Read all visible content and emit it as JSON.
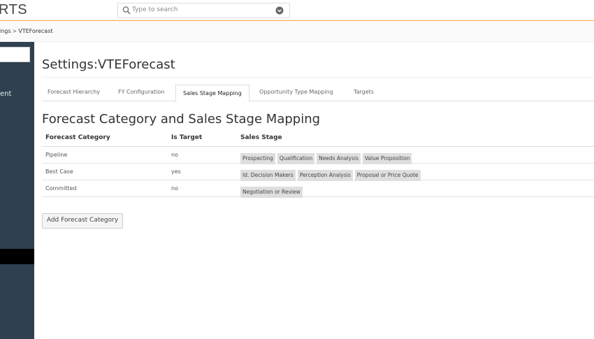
{
  "app": {
    "logo_text": "RTS"
  },
  "search": {
    "placeholder": "Type to search"
  },
  "breadcrumb": {
    "parent": "ings",
    "separator": ">",
    "current": "VTEForecast"
  },
  "sidebar": {
    "partial_item_label": "ent"
  },
  "page": {
    "title": "Settings:VTEForecast"
  },
  "tabs": [
    {
      "label": "Forecast Hierarchy",
      "active": false
    },
    {
      "label": "FY Configuration",
      "active": false
    },
    {
      "label": "Sales Stage Mapping",
      "active": true
    },
    {
      "label": "Opportunity Type Mapping",
      "active": false
    },
    {
      "label": "Targets",
      "active": false
    }
  ],
  "section": {
    "title": "Forecast Category and Sales Stage Mapping"
  },
  "table": {
    "headers": [
      "Forecast Category",
      "Is Target",
      "Sales Stage"
    ],
    "rows": [
      {
        "category": "Pipeline",
        "is_target": "no",
        "stages": [
          "Prospecting",
          "Qualification",
          "Needs Analysis",
          "Value Proposition"
        ]
      },
      {
        "category": "Best Case",
        "is_target": "yes",
        "stages": [
          "Id. Decision Makers",
          "Perception Analysis",
          "Proposal or Price Quote"
        ]
      },
      {
        "category": "Committed",
        "is_target": "no",
        "stages": [
          "Negotiation or Review"
        ]
      }
    ]
  },
  "actions": {
    "add_category_label": "Add Forecast Category"
  },
  "colors": {
    "sidebar_bg": "#2f4050",
    "accent_rule": "#f0a040",
    "stage_badge_bg": "#dedede"
  },
  "icons": {
    "search": "search-icon",
    "dropdown": "chevron-down-circle-icon"
  }
}
